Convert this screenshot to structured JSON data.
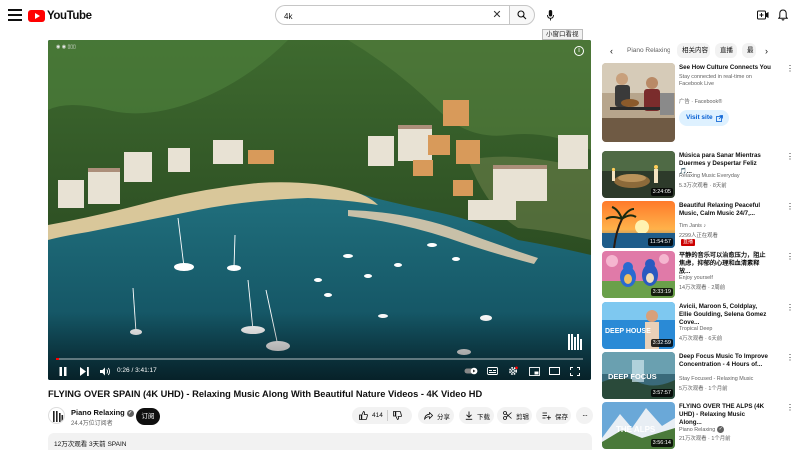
{
  "header": {
    "logo_text": "YouTube",
    "search_value": "4k",
    "pip_tooltip": "小窗口看视"
  },
  "player": {
    "time_current": "0:26",
    "time_separator": " / ",
    "time_total": "3:41:17",
    "progress": 0.002,
    "channel_watermark": "◉ ◉  ▯▯▯ "
  },
  "video": {
    "title": "FLYING OVER SPAIN (4K UHD) - Relaxing Music Along With Beautiful Nature Videos - 4K Video HD",
    "channel_name": "Piano Relaxing",
    "subscribers": "24.4万位订阅者",
    "subscribe_label": "订阅",
    "like_count": "414",
    "share_label": "分享",
    "download_label": "下载",
    "clip_label": "剪辑",
    "save_label": "保存",
    "views_meta": "12万次观看  3天前  SPAIN"
  },
  "sidebar": {
    "chips": [
      "Piano Relaxing",
      "相关内容",
      "直播",
      "最"
    ],
    "ad": {
      "title": "See How Culture Connects You",
      "description": "Stay connected in real-time on Facebook Live",
      "sponsor": "广告 · Facebook®",
      "button": "Visit site"
    },
    "items": [
      {
        "title": "Música para Sanar Mientras Duermes y Despertar Feliz 🎵...",
        "channel": "Relaxing Music Everyday",
        "meta": "5.3万次观看 · 8天前",
        "duration": "3:24:05",
        "live": ""
      },
      {
        "title": "Beautiful Relaxing Peaceful Music, Calm Music 24/7,...",
        "channel": "Tim Janis ♪",
        "meta": "2299人正在观看",
        "duration": "11:54:57",
        "live": "直播"
      },
      {
        "title": "平静的音乐可以治愈压力，阻止焦虑，抑郁的心理和血清素释放...",
        "channel": "Enjoy yourself",
        "meta": "14万次观看 · 2周前",
        "duration": "3:33:19",
        "live": ""
      },
      {
        "title": "Avicii, Maroon 5, Coldplay, Ellie Goulding, Selena Gomez Cove...",
        "channel": "Tropical Deep",
        "meta": "4万次观看 · 6天前",
        "duration": "3:32:59",
        "live": ""
      },
      {
        "title": "Deep Focus Music To Improve Concentration - 4 Hours of...",
        "channel": "Stay Focused - Relaxing Music",
        "meta": "5万次观看 · 1个月前",
        "duration": "3:57:57",
        "live": ""
      },
      {
        "title": "FLYING OVER THE ALPS (4K UHD) - Relaxing Music Along...",
        "channel": "Piano Relaxing",
        "meta": "21万次观看 · 1个月前",
        "duration": "3:56:14",
        "live": ""
      }
    ]
  },
  "thumb_text": {
    "deep_house": "DEEP HOUSE",
    "deep_focus": "DEEP FOCUS",
    "the_alps": "THE ALPS"
  }
}
